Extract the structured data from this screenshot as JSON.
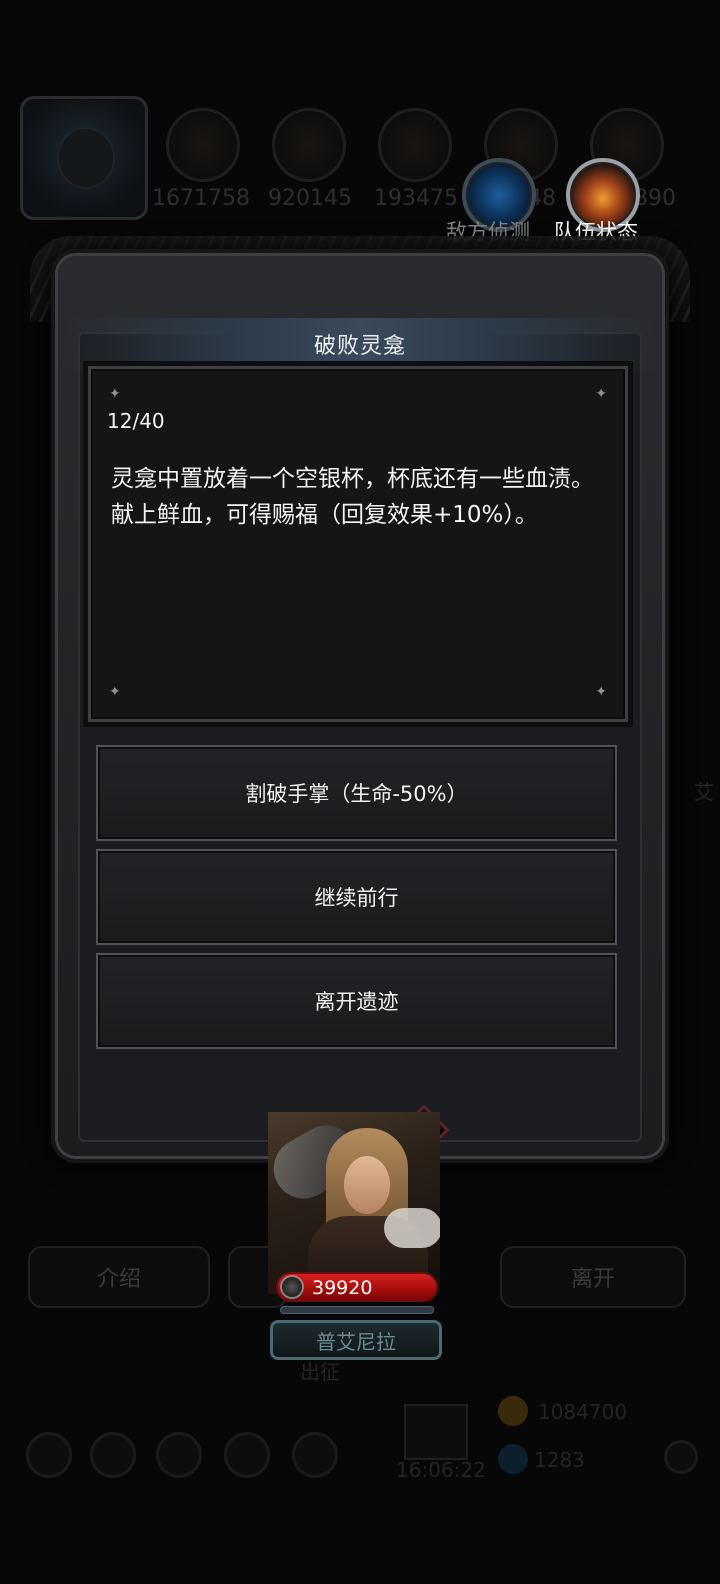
{
  "hud": {
    "resources": [
      {
        "icon": "orange-orb-icon",
        "value": "1671758"
      },
      {
        "icon": "gold-ingot-icon",
        "value": "920145"
      },
      {
        "icon": "stone-block-icon",
        "value": "193475"
      },
      {
        "icon": "blue-crystal-icon",
        "value": "148"
      },
      {
        "icon": "red-gem-icon",
        "value": "890"
      }
    ],
    "scout_label": "敌方侦测",
    "team_label": "队伍状态"
  },
  "background": {
    "intro_label": "介绍",
    "leave_label": "离开",
    "expedition_label": "出征",
    "gold_amount": "1084700",
    "gem_amount": "1283",
    "clock": "16:06:22",
    "edge_text": "艾"
  },
  "dialog": {
    "title": "破败灵龛",
    "progress": "12/40",
    "story_lines": [
      "灵龛中置放着一个空银杯，杯底还有一些血渍。",
      "献上鲜血，可得赐福（回复效果+10%）。"
    ],
    "choices": [
      {
        "label": "割破手掌（生命-50%）"
      },
      {
        "label": "继续前行"
      },
      {
        "label": "离开遗迹"
      }
    ]
  },
  "hero": {
    "hp": "39920",
    "name": "普艾尼拉"
  },
  "colors": {
    "hp_red": "#d82222",
    "title_bar": "#3a4a5c",
    "panel_bg": "#141517"
  }
}
